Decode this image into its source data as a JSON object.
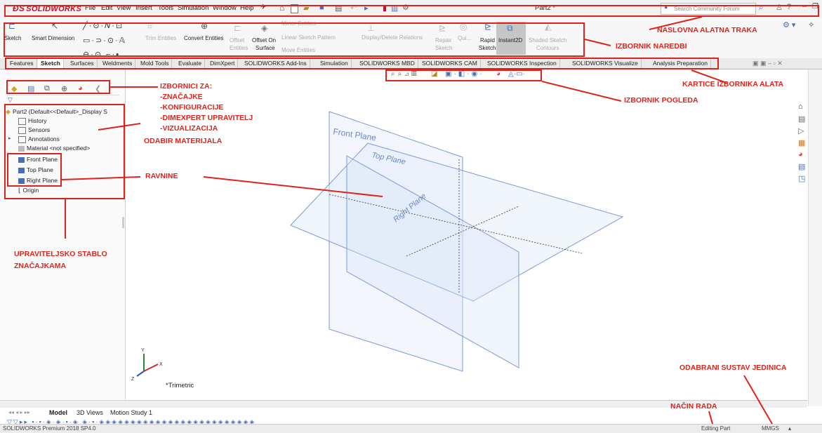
{
  "app": {
    "logo_text": "SOLIDWORKS",
    "document_title": "Part2 *",
    "menu": [
      "File",
      "Edit",
      "View",
      "Insert",
      "Tools",
      "Simulation",
      "Window",
      "Help"
    ],
    "search_placeholder": "Search Community Forum"
  },
  "command_manager": {
    "sketch": "Sketch",
    "smart_dimension": "Smart Dimension",
    "trim_entities": "Trim Entities",
    "convert_entities": "Convert Entities",
    "offset_entities_1": "Offset",
    "offset_entities_2": "Entities",
    "offset_on_surface_1": "Offset On",
    "offset_on_surface_2": "Surface",
    "mirror_entities": "Mirror Entities",
    "linear_sketch_pattern": "Linear Sketch Pattern",
    "move_entities": "Move Entities",
    "display_delete_relations": "Display/Delete Relations",
    "repair_sketch_1": "Repair",
    "repair_sketch_2": "Sketch",
    "quick_snaps": "Qui...",
    "rapid_sketch_1": "Rapid",
    "rapid_sketch_2": "Sketch",
    "instant2d": "Instant2D",
    "shaded_sketch_1": "Shaded Sketch",
    "shaded_sketch_2": "Contours"
  },
  "tabs": [
    "Features",
    "Sketch",
    "Surfaces",
    "Weldments",
    "Mold Tools",
    "Evaluate",
    "DimXpert",
    "SOLIDWORKS Add-Ins",
    "Simulation",
    "SOLIDWORKS MBD",
    "SOLIDWORKS CAM",
    "SOLIDWORKS Inspection",
    "SOLIDWORKS Visualize",
    "Analysis Preparation"
  ],
  "active_tab": "Sketch",
  "tree": {
    "root": "Part2  (Default<<Default>_Display S",
    "items": [
      "History",
      "Sensors",
      "Annotations",
      "Material <not specified>",
      "Front Plane",
      "Top Plane",
      "Right Plane",
      "Origin"
    ]
  },
  "viewport": {
    "front_plane": "Front Plane",
    "top_plane": "Top Plane",
    "right_plane": "Right Plane",
    "view_label": "*Trimetric"
  },
  "bottom_tabs": [
    "Model",
    "3D Views",
    "Motion Study 1"
  ],
  "status": {
    "left": "SOLIDWORKS Premium 2018 SP4.0",
    "mode": "Editing Part",
    "units": "MMGS"
  },
  "annotations": {
    "title_toolbar": "NASLOVNA ALATNA TRAKA",
    "command_menu": "IZBORNIK NAREDBI",
    "toolbar_tabs": "KARTICE IZBORNIKA ALATA",
    "view_menu": "IZBORNIK POGLEDA",
    "menus_for": "IZBORNICI ZA:",
    "menus_list": [
      "-ZNAČAJKE",
      "-KONFIGURACIJE",
      "-DIMEXPERT UPRAVITELJ",
      "-VIZUALIZACIJA"
    ],
    "material_choice": "ODABIR MATERIJALA",
    "planes": "RAVNINE",
    "feature_tree_1": "UPRAVITELJSKO STABLO",
    "feature_tree_2": "ZNAČAJKAMA",
    "unit_system": "ODABRANI SUSTAV JEDINICA",
    "work_mode": "NAČIN RADA"
  },
  "colors": {
    "annotation_red": "#e0231a",
    "plane_blue": "#6f93d6",
    "brand_red": "#c8102e"
  }
}
